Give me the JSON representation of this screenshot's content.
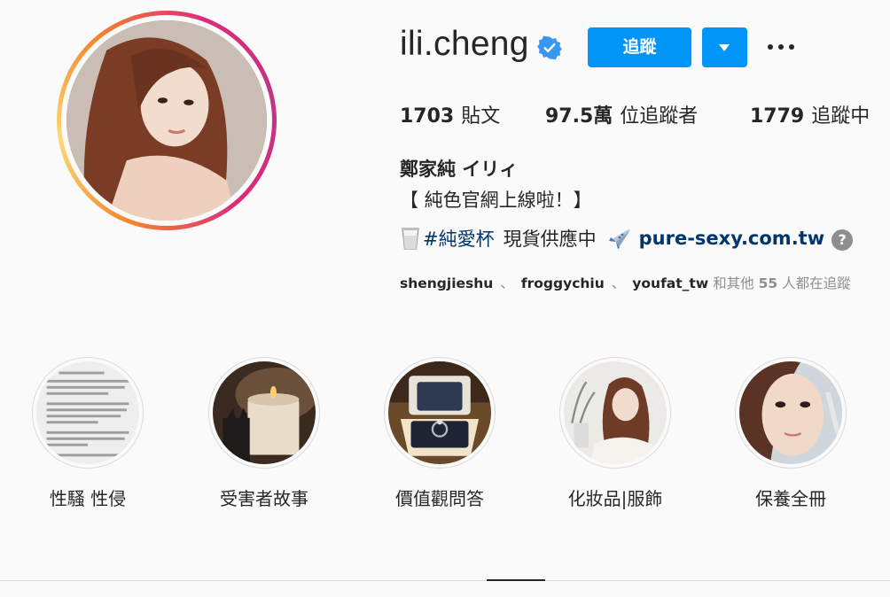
{
  "profile": {
    "username": "ili.cheng",
    "verified": true,
    "follow_label": "追蹤",
    "stats": {
      "posts_value": "1703",
      "posts_label": "貼文",
      "followers_value": "97.5萬",
      "followers_label": "位追蹤者",
      "following_value": "1779",
      "following_label": "追蹤中"
    },
    "full_name": "鄭家純 イリィ",
    "bio_line1": "【 純色官網上線啦！】",
    "bio_hashtag": "#純愛杯",
    "bio_text": "現貨供應中",
    "bio_link": "pure-sexy.com.tw",
    "followed_by": {
      "accounts": [
        "shengjieshu",
        "froggychiu",
        "youfat_tw"
      ],
      "separator": "、",
      "suffix": "和其他",
      "count": "55",
      "suffix_end": "人都在追蹤"
    }
  },
  "highlights": [
    {
      "label": "性騷 性侵"
    },
    {
      "label": "受害者故事"
    },
    {
      "label": "價值觀問答"
    },
    {
      "label": "化妝品|服飾"
    },
    {
      "label": "保養全冊"
    }
  ],
  "colors": {
    "accent": "#0095f6",
    "link": "#00376b",
    "muted": "#8e8e8e",
    "text": "#262626",
    "background": "#fafafa"
  },
  "icons": [
    "verified-badge-icon",
    "chevron-down-icon",
    "more-options-icon",
    "cup-emoji-icon",
    "airplane-emoji-icon",
    "question-mark-icon"
  ]
}
